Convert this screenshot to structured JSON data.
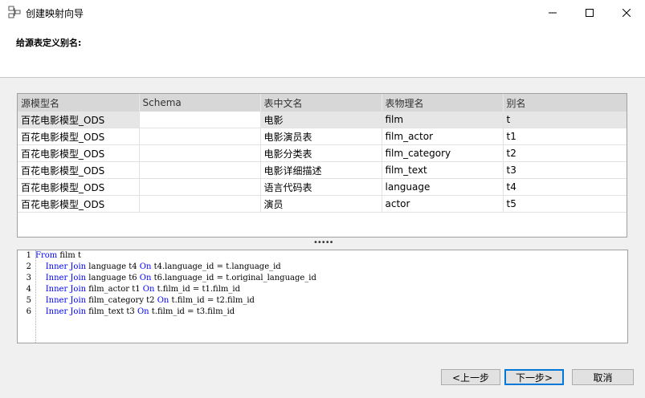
{
  "window": {
    "title": "创建映射向导",
    "controls": [
      "minimize-icon",
      "maximize-icon",
      "close-icon"
    ]
  },
  "header": {
    "label": "给源表定义别名:"
  },
  "table": {
    "columns": [
      "源模型名",
      "Schema",
      "表中文名",
      "表物理名",
      "别名"
    ],
    "rows": [
      [
        "百花电影模型_ODS",
        "",
        "电影",
        "film",
        "t"
      ],
      [
        "百花电影模型_ODS",
        "",
        "电影演员表",
        "film_actor",
        "t1"
      ],
      [
        "百花电影模型_ODS",
        "",
        "电影分类表",
        "film_category",
        "t2"
      ],
      [
        "百花电影模型_ODS",
        "",
        "电影详细描述",
        "film_text",
        "t3"
      ],
      [
        "百花电影模型_ODS",
        "",
        "语言代码表",
        "language",
        "t4"
      ],
      [
        "百花电影模型_ODS",
        "",
        "演员",
        "actor",
        "t5"
      ]
    ]
  },
  "splitter": {
    "grip": "•••••"
  },
  "sql": {
    "line_numbers": [
      "1",
      "2",
      "3",
      "4",
      "5",
      "6"
    ],
    "lines": [
      {
        "indent": "",
        "kw1": "From",
        "a": " film t",
        "kw2": "",
        "b": ""
      },
      {
        "indent": "    ",
        "kw1": "Inner Join",
        "a": " language t4 ",
        "kw2": "On",
        "b": " t4.language_id = t.language_id"
      },
      {
        "indent": "    ",
        "kw1": "Inner Join",
        "a": " language t6 ",
        "kw2": "On",
        "b": " t6.language_id = t.original_language_id"
      },
      {
        "indent": "    ",
        "kw1": "Inner Join",
        "a": " film_actor t1 ",
        "kw2": "On",
        "b": " t.film_id = t1.film_id"
      },
      {
        "indent": "    ",
        "kw1": "Inner Join",
        "a": " film_category t2 ",
        "kw2": "On",
        "b": " t.film_id = t2.film_id"
      },
      {
        "indent": "    ",
        "kw1": "Inner Join",
        "a": " film_text t3 ",
        "kw2": "On",
        "b": " t.film_id = t3.film_id"
      }
    ]
  },
  "buttons": {
    "prev": "<上一步",
    "next": "下一步>",
    "cancel": "取消"
  }
}
